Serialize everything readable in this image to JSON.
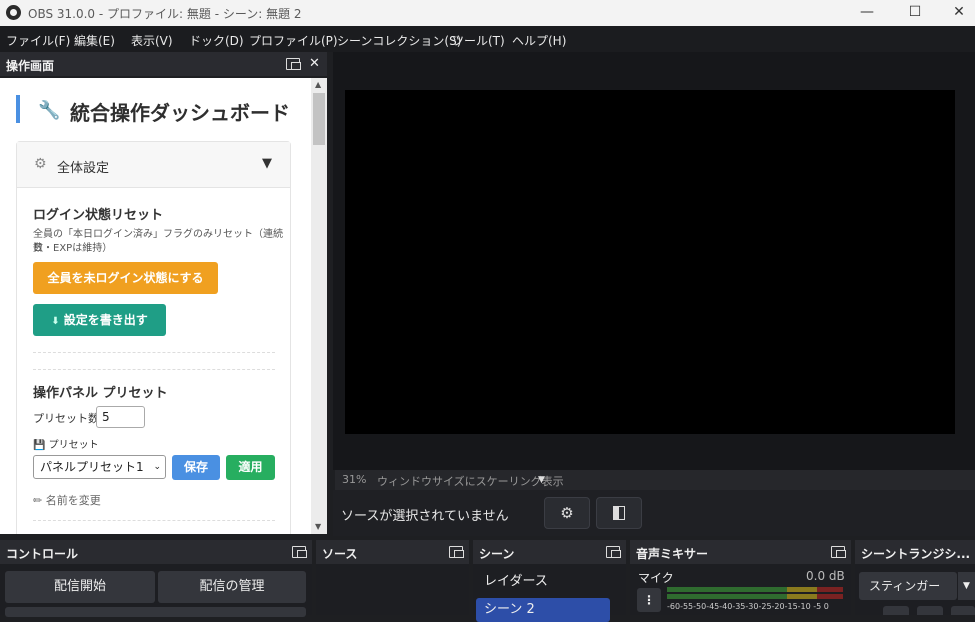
{
  "window": {
    "title": "OBS 31.0.0 - プロファイル: 無題 - シーン: 無題 2",
    "minimize": "—",
    "maximize": "☐",
    "close": "✕"
  },
  "menu": [
    "ファイル(F)",
    "編集(E)",
    "表示(V)",
    "ドック(D)",
    "プロファイル(P)",
    "シーンコレクション(S)",
    "ツール(T)",
    "ヘルプ(H)"
  ],
  "ops_dock": {
    "title": "操作画面",
    "close": "✕"
  },
  "dashboard": {
    "title": "統合操作ダッシュボード",
    "wrench": "🔧"
  },
  "card": {
    "title": "全体設定",
    "gear": "⚙",
    "caret": "▼"
  },
  "login_reset": {
    "title": "ログイン状態リセット",
    "desc_line1": "全員の「本日ログイン済み」フラグのみリセット（連続日",
    "desc_line2": "数・EXPは維持）",
    "reset_button": "全員を未ログイン状態にする",
    "export_button": "設定を書き出す",
    "export_icon": "⬇"
  },
  "preset": {
    "title": "操作パネル プリセット",
    "count_label": "プリセット数",
    "count_value": "5",
    "preset_label": "プリセット",
    "save_icon": "💾",
    "selected": "パネルプリセット1",
    "save_button": "保存",
    "apply_button": "適用",
    "rename": "名前を変更",
    "rename_icon": "✏"
  },
  "preview_bar": {
    "zoom": "31%",
    "mode": "ウィンドウサイズにスケーリング表示",
    "dropdown": "▼"
  },
  "source_bar": {
    "message": "ソースが選択されていません",
    "gear": "⚙"
  },
  "controls": {
    "title": "コントロール",
    "start_stream": "配信開始",
    "manage_stream": "配信の管理"
  },
  "sources": {
    "title": "ソース"
  },
  "scenes": {
    "title": "シーン",
    "items": [
      "レイダース",
      "シーン 2"
    ]
  },
  "mixer": {
    "title": "音声ミキサー",
    "channel": "マイク",
    "level": "0.0 dB",
    "scale": "-60-55-50-45-40-35-30-25-20-15-10 -5  0"
  },
  "transitions": {
    "title": "シーントランジシ...",
    "selected": "スティンガー",
    "dropdown": "▼"
  },
  "colors": {
    "accent_blue": "#4a90e2",
    "orange": "#f0a020",
    "teal": "#1f9e86",
    "green": "#27ae60",
    "save_blue": "#4a90e2",
    "scene_active": "#2d4ea8"
  }
}
